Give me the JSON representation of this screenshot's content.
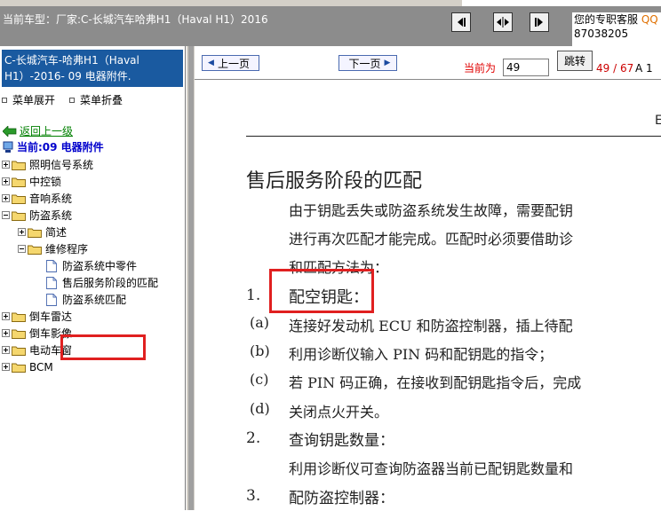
{
  "app": {
    "vehicle_title": "当前车型：厂家:C-长城汽车哈弗H1（Haval H1）2016",
    "support_label": "您的专职客服",
    "support_qq": "QQ",
    "support_number": "87038205"
  },
  "sidebar": {
    "header_line1": "C-长城汽车-哈弗H1（Haval",
    "header_line2": "H1）-2016- 09 电器附件.",
    "menu_expand": "菜单展开",
    "menu_collapse": "菜单折叠",
    "back_link": "返回上一级",
    "current": "当前:09 电器附件",
    "tree": [
      {
        "label": "照明信号系统",
        "type": "folder",
        "toggle": "plus"
      },
      {
        "label": "中控锁",
        "type": "folder",
        "toggle": "plus"
      },
      {
        "label": "音响系统",
        "type": "folder",
        "toggle": "plus"
      },
      {
        "label": "防盗系统",
        "type": "folder",
        "toggle": "minus"
      },
      {
        "label": "简述",
        "type": "folder",
        "toggle": "plus"
      },
      {
        "label": "维修程序",
        "type": "folder",
        "toggle": "minus"
      },
      {
        "label": "防盗系统中零件",
        "type": "doc"
      },
      {
        "label": "售后服务阶段的匹配",
        "type": "doc"
      },
      {
        "label": "防盗系统匹配",
        "type": "doc",
        "selected": true
      },
      {
        "label": "倒车雷达",
        "type": "folder",
        "toggle": "plus"
      },
      {
        "label": "倒车影像",
        "type": "folder",
        "toggle": "plus"
      },
      {
        "label": "电动车窗",
        "type": "folder",
        "toggle": "plus"
      },
      {
        "label": "BCM",
        "type": "folder",
        "toggle": "plus"
      }
    ]
  },
  "nav": {
    "prev": "上一页",
    "next": "下一页",
    "current_label": "当前为",
    "page_value": "49",
    "jump": "跳转",
    "page_count": "49 / 67",
    "font_sizes": "A 1"
  },
  "document": {
    "header_letter": "E",
    "title": "售后服务阶段的匹配",
    "para1": "由于钥匙丢失或防盗系统发生故障，需要配钥",
    "para2": "进行再次匹配才能完成。匹配时必须要借助诊",
    "para3": "和匹配方法为：",
    "s1_num": "1.",
    "s1_title": "配空钥匙：",
    "a_label": "(a)",
    "a_text": "连接好发动机 ECU 和防盗控制器，插上待配",
    "b_label": "(b)",
    "b_text": "利用诊断仪输入 PIN 码和配钥匙的指令；",
    "c_label": "(c)",
    "c_text": "若 PIN 码正确，在接收到配钥匙指令后，完成",
    "d_label": "(d)",
    "d_text": "关闭点火开关。",
    "s2_num": "2.",
    "s2_title": "查询钥匙数量：",
    "s2_text": "利用诊断仪可查询防盗器当前已配钥匙数量和",
    "s3_num": "3.",
    "s3_title": "配防盗控制器："
  },
  "colors": {
    "sidebar_header": "#1a5aa0",
    "highlight": "#e02020",
    "topbar": "#8c8c8c",
    "current_label": "#0000cc",
    "back_link": "#008000"
  }
}
